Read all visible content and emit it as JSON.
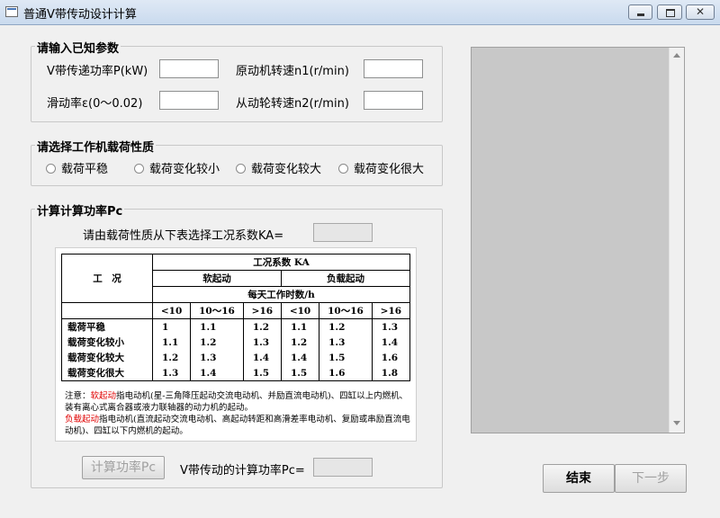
{
  "window": {
    "title": "普通V带传动设计计算",
    "minimize_label": "",
    "maximize_label": "",
    "close_label": "✕"
  },
  "known_params": {
    "legend": "请输入已知参数",
    "power_label": "V带传递功率P(kW)",
    "power_value": "",
    "speed_n1_label": "原动机转速n1(r/min)",
    "speed_n1_value": "",
    "slip_label": "滑动率ε(0～0.02)",
    "slip_value": "",
    "speed_n2_label": "从动轮转速n2(r/min)",
    "speed_n2_value": ""
  },
  "load_nature": {
    "legend": "请选择工作机载荷性质",
    "options": [
      "载荷平稳",
      "载荷变化较小",
      "载荷变化较大",
      "载荷变化很大"
    ]
  },
  "calc_power": {
    "legend": "计算计算功率Pc",
    "ka_prompt": "请由载荷性质从下表选择工况系数KA=",
    "ka_value": "",
    "calc_button": "计算功率Pc",
    "pc_label": "V带传动的计算功率Pc=",
    "pc_value": ""
  },
  "ka_table": {
    "title": "工况系数 KA",
    "condition_header": "工　况",
    "soft_start": "软起动",
    "load_start": "负载起动",
    "hours_header": "每天工作时数/h",
    "hour_cols": [
      "<10",
      "10～16",
      ">16",
      "<10",
      "10～16",
      ">16"
    ],
    "rows": [
      {
        "label": "载荷平稳",
        "values": [
          "1",
          "1.1",
          "1.2",
          "1.1",
          "1.2",
          "1.3"
        ]
      },
      {
        "label": "载荷变化较小",
        "values": [
          "1.1",
          "1.2",
          "1.3",
          "1.2",
          "1.3",
          "1.4"
        ]
      },
      {
        "label": "载荷变化较大",
        "values": [
          "1.2",
          "1.3",
          "1.4",
          "1.4",
          "1.5",
          "1.6"
        ]
      },
      {
        "label": "载荷变化很大",
        "values": [
          "1.3",
          "1.4",
          "1.5",
          "1.5",
          "1.6",
          "1.8"
        ]
      }
    ],
    "note_prefix": "注意：",
    "note_soft_term": "软起动",
    "note_soft_text": "指电动机(星-三角降压起动交流电动机、并励直流电动机)、四缸以上内燃机、装有离心式离合器或液力联轴器的动力机的起动。",
    "note_load_term": "负载起动",
    "note_load_text": "指电动机(直流起动交流电动机、高起动转距和高滑差率电动机、复励或串励直流电动机)、四缸以下内燃机的起动。"
  },
  "actions": {
    "finish": "结束",
    "next": "下一步"
  }
}
